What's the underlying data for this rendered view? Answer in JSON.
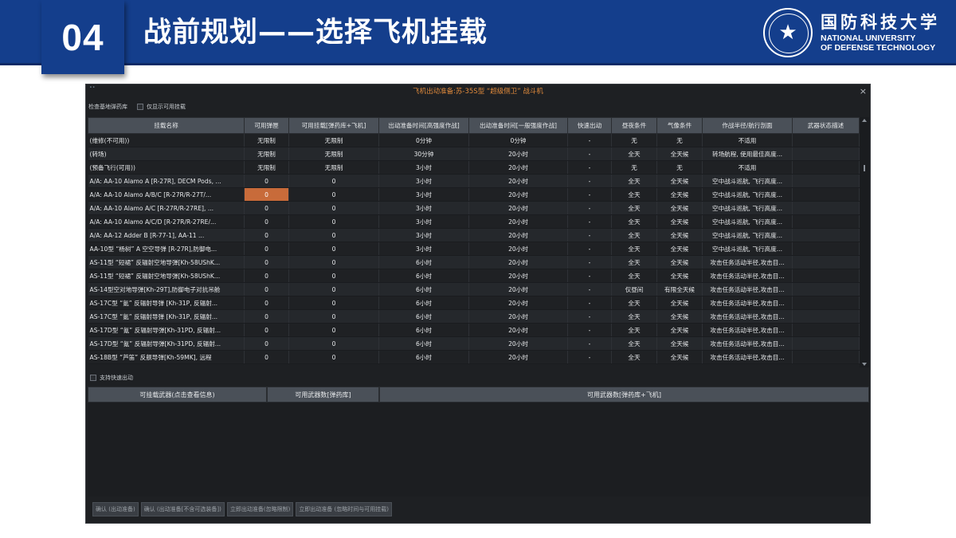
{
  "slide": {
    "number": "04",
    "title": "战前规划——选择飞机挂载",
    "university_cn": "国防科技大学",
    "university_en_line1": "NATIONAL UNIVERSITY",
    "university_en_line2": "OF DEFENSE TECHNOLOGY",
    "brand_color": "#143e8c"
  },
  "window": {
    "title": "飞机出动准备:苏-35S型 “超级侧卫” 战斗机",
    "title_color": "#e08a3c",
    "close_icon": "×",
    "filter_label": "检查基地弹药库",
    "only_available_label": "仅显示可用挂载",
    "quick_launch_label": "支持快速出动",
    "selected_cell_color": "#c86b3a"
  },
  "grid": {
    "columns": [
      "挂载名称",
      "可用弹匣",
      "可用挂载[弹药库+飞机]",
      "出动准备时间[高强度作战]",
      "出动准备时间[一般强度作战]",
      "快速出动",
      "昼夜条件",
      "气像条件",
      "作战半径/航行剖面",
      "武器状态描述"
    ],
    "rows": [
      [
        "(维修(不可用))",
        "无限制",
        "无限制",
        "0分钟",
        "0分钟",
        "-",
        "无",
        "无",
        "不适用",
        ""
      ],
      [
        "(转场)",
        "无限制",
        "无限制",
        "30分钟",
        "20小时",
        "-",
        "全天",
        "全天候",
        "转场航程, 使用最佳高度...",
        ""
      ],
      [
        "(预备飞行(可用))",
        "无限制",
        "无限制",
        "3小时",
        "20小时",
        "-",
        "无",
        "无",
        "不适用",
        ""
      ],
      [
        "A/A: AA-10 Alamo A [R-27R], DECM Pods, ...",
        "0",
        "0",
        "3小时",
        "20小时",
        "-",
        "全天",
        "全天候",
        "空中战斗巡航, 飞行高度...",
        ""
      ],
      [
        "A/A: AA-10 Alamo A/B/C [R-27R/R-27T/...",
        "0",
        "0",
        "3小时",
        "20小时",
        "-",
        "全天",
        "全天候",
        "空中战斗巡航, 飞行高度...",
        ""
      ],
      [
        "A/A: AA-10 Alamo A/C [R-27R/R-27RE], ...",
        "0",
        "0",
        "3小时",
        "20小时",
        "-",
        "全天",
        "全天候",
        "空中战斗巡航, 飞行高度...",
        ""
      ],
      [
        "A/A: AA-10 Alamo A/C/D [R-27R/R-27RE/...",
        "0",
        "0",
        "3小时",
        "20小时",
        "-",
        "全天",
        "全天候",
        "空中战斗巡航, 飞行高度...",
        ""
      ],
      [
        "A/A: AA-12 Adder B [R-77-1], AA-11 ...",
        "0",
        "0",
        "3小时",
        "20小时",
        "-",
        "全天",
        "全天候",
        "空中战斗巡航, 飞行高度...",
        ""
      ],
      [
        "AA-10型 “杨树” A 空空导弹 [R-27R],防御电...",
        "0",
        "0",
        "3小时",
        "20小时",
        "-",
        "全天",
        "全天候",
        "空中战斗巡航, 飞行高度...",
        ""
      ],
      [
        "AS-11型 “短裙” 反辐射空地导弹[Kh-58UShK...",
        "0",
        "0",
        "6小时",
        "20小时",
        "-",
        "全天",
        "全天候",
        "攻击任务活动半径,攻击目...",
        ""
      ],
      [
        "AS-11型 “短裙” 反辐射空地导弹[Kh-58UShK...",
        "0",
        "0",
        "6小时",
        "20小时",
        "-",
        "全天",
        "全天候",
        "攻击任务活动半径,攻击目...",
        ""
      ],
      [
        "AS-14型空对地导弹[Kh-29T],防御电子对抗吊舱",
        "0",
        "0",
        "6小时",
        "20小时",
        "-",
        "仅昼间",
        "有限全天候",
        "攻击任务活动半径,攻击目...",
        ""
      ],
      [
        "AS-17C型 “氪” 反辐射导弹 [Kh-31P, 反辐射...",
        "0",
        "0",
        "6小时",
        "20小时",
        "-",
        "全天",
        "全天候",
        "攻击任务活动半径,攻击目...",
        ""
      ],
      [
        "AS-17C型 “氪” 反辐射导弹 [Kh-31P, 反辐射...",
        "0",
        "0",
        "6小时",
        "20小时",
        "-",
        "全天",
        "全天候",
        "攻击任务活动半径,攻击目...",
        ""
      ],
      [
        "AS-17D型 “氪” 反辐射导弹[Kh-31PD, 反辐射...",
        "0",
        "0",
        "6小时",
        "20小时",
        "-",
        "全天",
        "全天候",
        "攻击任务活动半径,攻击目...",
        ""
      ],
      [
        "AS-17D型 “氪” 反辐射导弹[Kh-31PD, 反辐射...",
        "0",
        "0",
        "6小时",
        "20小时",
        "-",
        "全天",
        "全天候",
        "攻击任务活动半径,攻击目...",
        ""
      ],
      [
        "AS-18B型 “芦笛” 反舰导弹[Kh-59MK], 远程",
        "0",
        "0",
        "6小时",
        "20小时",
        "-",
        "全天",
        "全天候",
        "攻击任务活动半径,攻击目...",
        ""
      ]
    ],
    "selected_row": 4,
    "selected_col": 1
  },
  "weapons_panel": {
    "columns": [
      "可挂载武器(点击查看信息)",
      "可用武器数[弹药库]",
      "可用武器数[弹药库+飞机]"
    ]
  },
  "buttons": [
    "确认 (出动准备)",
    "确认 (出动准备[不含可选装备])",
    "立即出动准备(忽略限制)",
    "立即出动准备 (忽略时间与可用挂载)"
  ]
}
